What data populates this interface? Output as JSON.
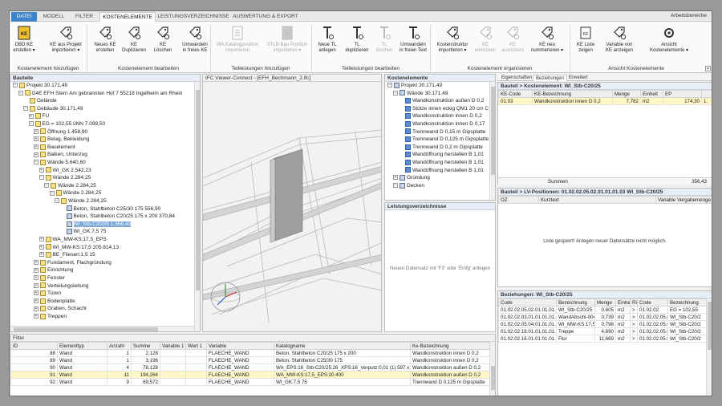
{
  "tabs": [
    "DATEI",
    "MODELL",
    "FILTER",
    "KOSTENELEMENTE",
    "LEISTUNGSVERZEICHNISSE",
    "AUSWERTUNG & EXPORT"
  ],
  "workspace_menu": "Arbeitsbereiche",
  "ribbon": {
    "groups": [
      "Kostenelement hinzufügen",
      "Kostenelement bearbeiten",
      "Teilleistungen hinzufügen",
      "Teilleistungen bearbeiten",
      "Kostenelement organisieren",
      "Ansicht Kostenelemente"
    ],
    "buttons": [
      {
        "icon": "dbd-ke-icon",
        "line1": "DBD KE",
        "line2": "erstellen ▾",
        "enabled": true
      },
      {
        "icon": "import-icon",
        "line1": "KE aus Projekt",
        "line2": "importieren ▾",
        "enabled": true
      },
      {
        "icon": "new-tag-icon",
        "line1": "Neues KE",
        "line2": "erstellen",
        "enabled": true
      },
      {
        "icon": "duplicate-tag-icon",
        "line1": "KE",
        "line2": "Duplizieren",
        "enabled": true
      },
      {
        "icon": "delete-tag-icon",
        "line1": "KE",
        "line2": "Löschen",
        "enabled": true
      },
      {
        "icon": "convert-tag-icon",
        "line1": "Umwandeln",
        "line2": "in freies KE",
        "enabled": true
      },
      {
        "icon": "catalog-icon",
        "line1": "WA Katalogposition",
        "line2": "importieren",
        "enabled": false
      },
      {
        "icon": "stlb-icon",
        "line1": "STLB-Bau Position",
        "line2": "importieren ▾",
        "enabled": false
      },
      {
        "icon": "new-tl-icon",
        "line1": "Neue TL",
        "line2": "anlegen",
        "enabled": true
      },
      {
        "icon": "duplicate-tl-icon",
        "line1": "TL",
        "line2": "duplizieren",
        "enabled": true
      },
      {
        "icon": "delete-tl-icon",
        "line1": "TL",
        "line2": "löschen",
        "enabled": false
      },
      {
        "icon": "convert-text-icon",
        "line1": "Umwandeln",
        "line2": "in freien Text",
        "enabled": true
      },
      {
        "icon": "structure-import-icon",
        "line1": "Kostenstruktur",
        "line2": "importieren ▾",
        "enabled": true
      },
      {
        "icon": "indent-icon",
        "line1": "KE",
        "line2": "einrücken",
        "enabled": false
      },
      {
        "icon": "outdent-icon",
        "line1": "KE",
        "line2": "ausrücken",
        "enabled": false
      },
      {
        "icon": "renumber-icon",
        "line1": "KE neu",
        "line2": "nummerieren ▾",
        "enabled": true
      },
      {
        "icon": "list-icon",
        "line1": "KE Liste",
        "line2": "zeigen",
        "enabled": true
      },
      {
        "icon": "variable-icon",
        "line1": "Variable von",
        "line2": "KE anzeigen",
        "enabled": true
      },
      {
        "icon": "settings-icon",
        "line1": "Ansicht",
        "line2": "Kostenelemente ▾",
        "enabled": true
      }
    ]
  },
  "bauteile": {
    "title": "Bauteile",
    "rows": [
      {
        "level": 0,
        "toggle": "⊟",
        "icon": "ye",
        "text": "Projekt  30.171,49"
      },
      {
        "level": 1,
        "toggle": "⊟",
        "icon": "ye",
        "text": "G4E EFH Stern Am gebrannten Hof 7 55218 Ingelheim am Rhein"
      },
      {
        "level": 2,
        "toggle": "",
        "icon": "ye",
        "text": "Gelände"
      },
      {
        "level": 2,
        "toggle": "⊟",
        "icon": "ye",
        "text": "Gebäude  30.171,49"
      },
      {
        "level": 3,
        "toggle": "⊞",
        "icon": "ye",
        "text": "FU"
      },
      {
        "level": 3,
        "toggle": "⊟",
        "icon": "ye",
        "text": "EG = 102,55 üNN  7.099,50"
      },
      {
        "level": 4,
        "toggle": "⊞",
        "icon": "ye",
        "text": "Öffnung  1.458,90"
      },
      {
        "level": 4,
        "toggle": "⊞",
        "icon": "ye",
        "text": "Belag, Bekleidung"
      },
      {
        "level": 4,
        "toggle": "⊞",
        "icon": "ye",
        "text": "Bauelement"
      },
      {
        "level": 4,
        "toggle": "⊞",
        "icon": "ye",
        "text": "Balken, Unterzug"
      },
      {
        "level": 4,
        "toggle": "⊟",
        "icon": "ye",
        "text": "Wände  5.640,60"
      },
      {
        "level": 5,
        "toggle": "⊞",
        "icon": "ye",
        "text": "WI_GK  2.542,23"
      },
      {
        "level": 5,
        "toggle": "⊟",
        "icon": "ye",
        "text": "Wände  2.284,25"
      },
      {
        "level": 6,
        "toggle": "⊟",
        "icon": "ye",
        "text": "Wände  2.284,25"
      },
      {
        "level": 7,
        "toggle": "⊟",
        "icon": "ye",
        "text": "Wände  2.284,25"
      },
      {
        "level": 8,
        "toggle": "⊟",
        "icon": "ye",
        "text": "Wände  2.284,25"
      },
      {
        "level": 9,
        "toggle": "",
        "icon": "cube",
        "text": "Beton, Stahlbeton C25/30 175  556,90"
      },
      {
        "level": 9,
        "toggle": "",
        "icon": "cube",
        "text": "Beton, Stahlbeton C20/25 175 x 200  370,84"
      },
      {
        "level": 9,
        "toggle": "",
        "icon": "cube",
        "text": "WI_Stb-C20/25  1.356,43",
        "selected": true
      },
      {
        "level": 9,
        "toggle": "",
        "icon": "cube",
        "text": "WI_GK:7,5 75"
      },
      {
        "level": 5,
        "toggle": "⊞",
        "icon": "ye",
        "text": "WA_MW-KS:17,5_EPS"
      },
      {
        "level": 5,
        "toggle": "⊞",
        "icon": "ye",
        "text": "WI_MW-KS:17,5 205  814,13"
      },
      {
        "level": 5,
        "toggle": "⊞",
        "icon": "ye",
        "text": "BE_Fliesen:1,5 15"
      },
      {
        "level": 4,
        "toggle": "⊞",
        "icon": "ye",
        "text": "Fundament, Flachgründung"
      },
      {
        "level": 4,
        "toggle": "⊞",
        "icon": "ye",
        "text": "Einrichtung"
      },
      {
        "level": 4,
        "toggle": "⊞",
        "icon": "ye",
        "text": "Fenster"
      },
      {
        "level": 4,
        "toggle": "⊞",
        "icon": "ye",
        "text": "Verteilungsleitung"
      },
      {
        "level": 4,
        "toggle": "⊞",
        "icon": "ye",
        "text": "Türen"
      },
      {
        "level": 4,
        "toggle": "⊞",
        "icon": "ye",
        "text": "Bodenplatte"
      },
      {
        "level": 4,
        "toggle": "⊞",
        "icon": "ye",
        "text": "Graben, Schacht"
      },
      {
        "level": 4,
        "toggle": "⊞",
        "icon": "ye",
        "text": "Treppen"
      }
    ]
  },
  "viewer": {
    "title": "IFC Viewer-Connect - [EFH_Bechmann_2.ifc]"
  },
  "kostenelemente": {
    "title": "Kostenelemente",
    "rows": [
      {
        "level": 0,
        "toggle": "⊟",
        "icon": "cube",
        "text": "Projekt  30.171,49"
      },
      {
        "level": 1,
        "toggle": "⊟",
        "icon": "cube",
        "text": "Wände  30.171,49"
      },
      {
        "level": 2,
        "toggle": "",
        "icon": "wall",
        "text": "Wandkonstruktion außen D 0,2"
      },
      {
        "level": 2,
        "toggle": "",
        "icon": "wall",
        "text": "Stütze innen eckig QM1 20 cm C"
      },
      {
        "level": 2,
        "toggle": "",
        "icon": "wall",
        "text": "Wandkonstruktion innen D 0,2"
      },
      {
        "level": 2,
        "toggle": "",
        "icon": "wall",
        "text": "Wandkonstruktion innen D 0,17"
      },
      {
        "level": 2,
        "toggle": "",
        "icon": "wall",
        "text": "Trennwand D 0,15 m Gipsplatte"
      },
      {
        "level": 2,
        "toggle": "",
        "icon": "wall",
        "text": "Trennwand D 0,125 m Gipsplatte"
      },
      {
        "level": 2,
        "toggle": "",
        "icon": "wall",
        "text": "Trennwand D 0,2 m Gipsplatte"
      },
      {
        "level": 2,
        "toggle": "",
        "icon": "wall",
        "text": "Wandöffnung herstellen B 1,01"
      },
      {
        "level": 2,
        "toggle": "",
        "icon": "wall",
        "text": "Wandöffnung herstellen B 1,01"
      },
      {
        "level": 2,
        "toggle": "",
        "icon": "wall",
        "text": "Wandöffnung herstellen B 1,01"
      },
      {
        "level": 1,
        "toggle": "⊞",
        "icon": "cube",
        "text": "Gründung"
      },
      {
        "level": 1,
        "toggle": "⊟",
        "icon": "cube",
        "text": "Decken"
      }
    ]
  },
  "leistungsverzeichnisse": {
    "title": "Leistungsverzeichnisse",
    "hint": "Neuen Datensatz mit 'F3' oder 'Einfg' anlegen"
  },
  "right_tabs": [
    "Eigenschaften",
    "Beziehungen",
    "Erweitert"
  ],
  "kostenelement_panel": {
    "title": "Bauteil > Kostenelement: WI_Stb-C20/25",
    "headers": [
      "KE-Code",
      "KE-Bezeichnung",
      "Menge",
      "Einheit",
      "EP",
      ""
    ],
    "rows": [
      [
        "01.03",
        "Wandkonstruktion innen D 0,2",
        "7,782",
        "m2",
        "174,30",
        "1."
      ]
    ],
    "summe_label": "Summen",
    "summe_value": "356,43"
  },
  "lv_panel": {
    "title": "Bauteil > LV-Positionen: 01.02.02.05.02.01.01.01.03 WI_Stb-C20/25",
    "headers": [
      "OZ",
      "Kurztext",
      "Variable Vergabemenge"
    ],
    "locked": "Liste gesperrt! Anlegen neuer Datensätze nicht möglich."
  },
  "bez_panel": {
    "title": "Beziehungen: WI_Stb-C20/25",
    "headers": [
      "Code",
      "Bezeichnung",
      "Menge",
      "Einheit",
      "Ri",
      "Code",
      "Bezeichnung"
    ],
    "rows": [
      [
        "01.02.02.05.02.01.01.01.03",
        "WI_Stb-C20/25",
        "0,605",
        "m2",
        ">",
        "01.02.02",
        "EG = 102,55"
      ],
      [
        "01.02.02.03.01.01.01.01.01",
        "WandAbschl-004",
        "0,739",
        "m2",
        ">",
        "01.02.02.05.0",
        "WI_Stb-C20/2"
      ],
      [
        "01.02.02.05.04.01.01.01.01",
        "WI_MW-KS:17,5_2",
        "0,798",
        "m2",
        ">",
        "01.02.02.05.0",
        "WI_Stb-C20/2"
      ],
      [
        "01.02.02.16.01.01.01.01.02",
        "Treppe",
        "4,690",
        "m2",
        ">",
        "01.02.02.05.0",
        "WI_Stb-C20/2"
      ],
      [
        "01.02.02.16.01.01.01.01.09",
        "Flur",
        "11,669",
        "m2",
        ">",
        "01.02.02.05.0",
        "WI_Stb-C20/2"
      ]
    ]
  },
  "filter": {
    "title": "Filter",
    "headers": [
      "ID",
      "Elementtyp",
      "Anzahl",
      "Summe",
      "Variable 1",
      "Wert 1",
      "Variable",
      "Katalogname",
      "Ke-Bezeichnung"
    ],
    "rows": [
      [
        "88",
        "Wand",
        "1",
        "2,128",
        "",
        "",
        "FLAECHE_WAND",
        "Beton, Stahlbeton C20/25 175 x 200",
        "Wandkonstruktion innen D 0,2"
      ],
      [
        "89",
        "Wand",
        "1",
        "3,196",
        "",
        "",
        "FLAECHE_WAND",
        "Beton, Stahlbeton C25/30 175",
        "Wandkonstruktion innen D 0,2"
      ],
      [
        "90",
        "Wand",
        "4",
        "78,128",
        "",
        "",
        "FLAECHE_WAND",
        "WA_EPS:16_Stb-C20/25:26_XPS:16_Verputz:0,01 (1) 597 x 615",
        "Wandkonstruktion außen D 0,2"
      ],
      [
        "91",
        "Wand",
        "11",
        "194,264",
        "",
        "",
        "FLAECHE_WAND",
        "WA_MW-KS:17,5_EPS:20 400",
        "Wandkonstruktion außen D 0,2"
      ],
      [
        "92",
        "Wand",
        "9",
        "69,572",
        "",
        "",
        "FLAECHE_WAND",
        "WI_GK:7,5 75",
        "Trennwand D 0,125 m Gipsplatte"
      ]
    ],
    "highlight_row": 3
  }
}
